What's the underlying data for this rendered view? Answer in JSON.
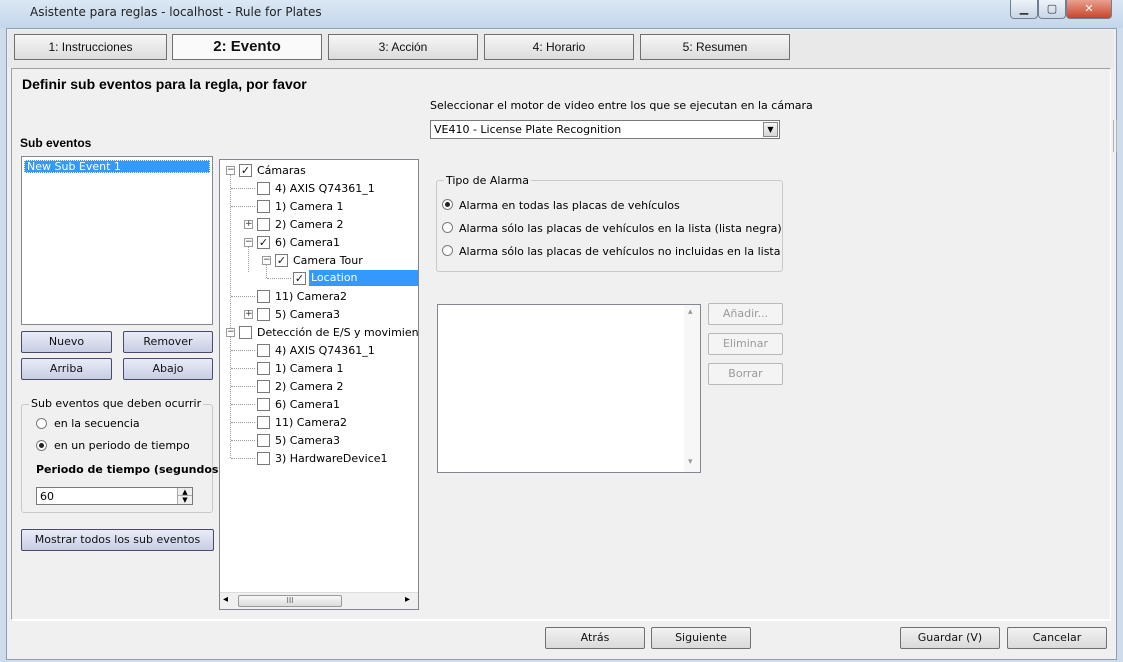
{
  "window": {
    "title": "Asistente para reglas - localhost - Rule for Plates",
    "minimize_icon": "minimize-icon",
    "maximize_icon": "maximize-icon",
    "close_icon": "close-icon"
  },
  "tabs": [
    {
      "label": "1: Instrucciones",
      "active": false
    },
    {
      "label": "2: Evento",
      "active": true
    },
    {
      "label": "3: Acción",
      "active": false
    },
    {
      "label": "4: Horario",
      "active": false
    },
    {
      "label": "5: Resumen",
      "active": false
    }
  ],
  "heading": "Definir sub eventos para la regla, por favor",
  "sub_events": {
    "title": "Sub eventos",
    "items": [
      "New Sub Event 1"
    ],
    "buttons": {
      "new": "Nuevo",
      "remove": "Remover",
      "up": "Arriba",
      "down": "Abajo"
    },
    "group": {
      "title": "Sub eventos que deben ocurrir",
      "options": [
        {
          "label": "en la secuencia",
          "selected": false
        },
        {
          "label": "en un periodo de tiempo",
          "selected": true
        }
      ],
      "period_label": "Periodo de tiempo (segundos):",
      "period_value": "60"
    },
    "show_all_button": "Mostrar todos los sub eventos"
  },
  "tree": {
    "rows": [
      {
        "text": "Cámaras",
        "checked": true,
        "expander": "−"
      },
      {
        "text": "4) AXIS Q74361_1",
        "checked": false,
        "expander": ""
      },
      {
        "text": "1) Camera 1",
        "checked": false,
        "expander": ""
      },
      {
        "text": "2) Camera 2",
        "checked": false,
        "expander": "+"
      },
      {
        "text": "6) Camera1",
        "checked": true,
        "expander": "−"
      },
      {
        "text": "Camera Tour",
        "checked": true,
        "expander": "−"
      },
      {
        "text": "Location",
        "checked": true,
        "expander": "",
        "selected": true
      },
      {
        "text": "11) Camera2",
        "checked": false,
        "expander": ""
      },
      {
        "text": "5) Camera3",
        "checked": false,
        "expander": "+"
      },
      {
        "text": "Detección de E/S y movimiento e",
        "checked": false,
        "expander": "−"
      },
      {
        "text": "4) AXIS Q74361_1",
        "checked": false,
        "expander": ""
      },
      {
        "text": "1) Camera 1",
        "checked": false,
        "expander": ""
      },
      {
        "text": "2) Camera 2",
        "checked": false,
        "expander": ""
      },
      {
        "text": "6) Camera1",
        "checked": false,
        "expander": ""
      },
      {
        "text": "11) Camera2",
        "checked": false,
        "expander": ""
      },
      {
        "text": "5) Camera3",
        "checked": false,
        "expander": ""
      },
      {
        "text": "3) HardwareDevice1",
        "checked": false,
        "expander": ""
      }
    ],
    "hscroll_left": "◂",
    "hscroll_right": "▸",
    "hscroll_thumb": "III"
  },
  "engine": {
    "label": "Seleccionar el motor de video entre los que se ejecutan en la cámara",
    "selected": "VE410 - License Plate Recognition",
    "arrow": "▼"
  },
  "alarm": {
    "title": "Tipo de Alarma",
    "options": [
      {
        "label": "Alarma en todas las placas de vehículos",
        "selected": true
      },
      {
        "label": "Alarma sólo las placas de vehículos en la lista (lista negra)",
        "selected": false
      },
      {
        "label": "Alarma sólo las placas de vehículos no incluidas en la lista (lista",
        "selected": false
      }
    ]
  },
  "plate_list": {
    "scroll_up": "▴",
    "scroll_down": "▾",
    "buttons": {
      "add": "Añadir...",
      "delete": "Eliminar",
      "clear": "Borrar"
    }
  },
  "footer": {
    "back": "Atrás",
    "next": "Siguiente",
    "save": "Guardar (V)",
    "cancel": "Cancelar"
  }
}
